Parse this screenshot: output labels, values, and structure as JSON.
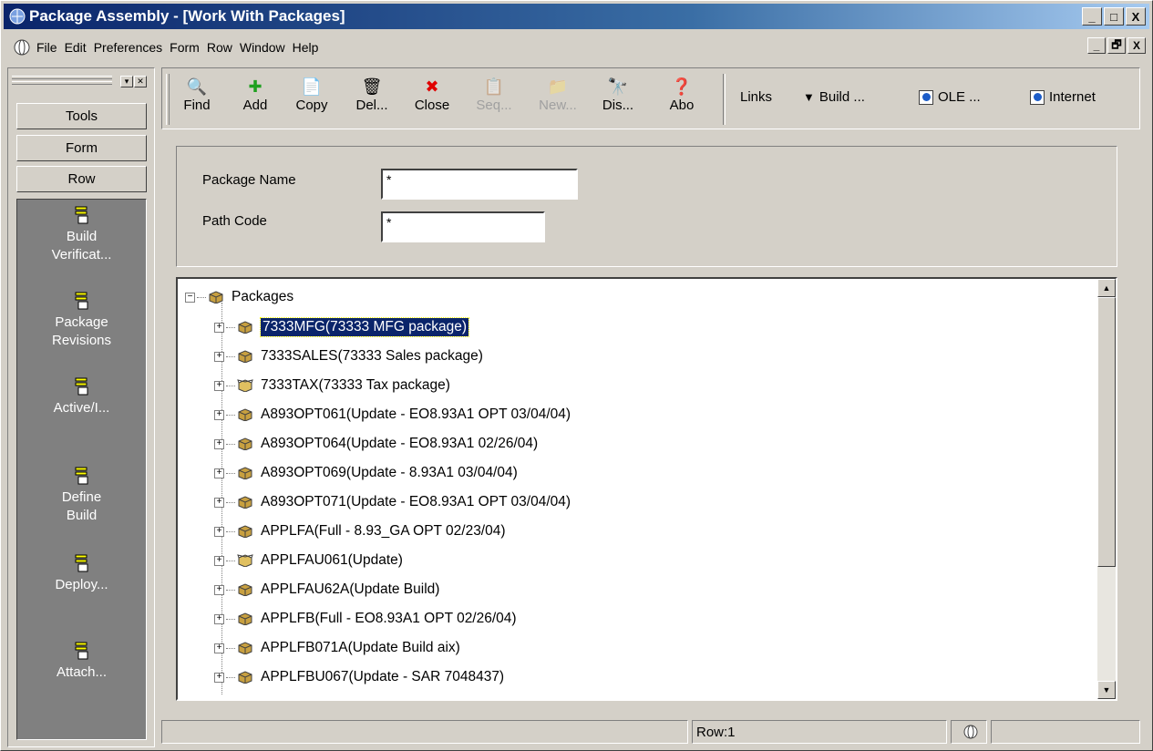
{
  "window": {
    "title": "Package Assembly - [Work With Packages]",
    "caption_buttons": [
      "_",
      "□",
      "X"
    ],
    "mdi_buttons": [
      "_",
      "🗗",
      "X"
    ]
  },
  "menu": [
    "File",
    "Edit",
    "Preferences",
    "Form",
    "Row",
    "Window",
    "Help"
  ],
  "left_panel": {
    "sections": [
      "Tools",
      "Form",
      "Row"
    ],
    "items": [
      "Build\nVerificat...",
      "Package\nRevisions",
      "Active/I...",
      "Define\nBuild",
      "Deploy...",
      "Attach..."
    ]
  },
  "toolbar": {
    "buttons": [
      {
        "label": "Find",
        "u": "i",
        "icon": "find-icon",
        "glyph": "🔍",
        "disabled": false
      },
      {
        "label": "Add",
        "u": "A",
        "icon": "add-icon",
        "glyph": "✚",
        "disabled": false
      },
      {
        "label": "Copy",
        "u": "y",
        "icon": "copy-icon",
        "glyph": "📄",
        "disabled": false
      },
      {
        "label": "Del...",
        "u": "D",
        "icon": "delete-icon",
        "glyph": "🗑",
        "disabled": false
      },
      {
        "label": "Close",
        "u": "C",
        "icon": "close-icon",
        "glyph": "✖",
        "disabled": false
      },
      {
        "label": "Seq...",
        "u": "",
        "icon": "seq-icon",
        "glyph": "📋",
        "disabled": true
      },
      {
        "label": "New...",
        "u": "",
        "icon": "new-icon",
        "glyph": "📁",
        "disabled": true
      },
      {
        "label": "Dis...",
        "u": "",
        "icon": "display-icon",
        "glyph": "🔭",
        "disabled": false
      },
      {
        "label": "Abo",
        "u": "b",
        "icon": "about-icon",
        "glyph": "❓",
        "disabled": false
      }
    ],
    "links": [
      {
        "label": "Links",
        "icon": ""
      },
      {
        "label": "Build ...",
        "icon": "dropdown-arrow-icon"
      },
      {
        "label": "OLE ...",
        "icon": "ole-icon"
      },
      {
        "label": "Internet",
        "icon": "internet-icon"
      }
    ]
  },
  "query": {
    "package_name_label": "Package Name",
    "package_name_value": "*",
    "path_code_label": "Path Code",
    "path_code_value": "*"
  },
  "tree": {
    "root": "Packages",
    "items": [
      {
        "text": "7333MFG(73333 MFG package)",
        "selected": true,
        "open_box": false
      },
      {
        "text": "7333SALES(73333 Sales package)",
        "selected": false,
        "open_box": false
      },
      {
        "text": "7333TAX(73333 Tax package)",
        "selected": false,
        "open_box": true
      },
      {
        "text": "A893OPT061(Update - EO8.93A1 OPT 03/04/04)",
        "selected": false,
        "open_box": false
      },
      {
        "text": "A893OPT064(Update - EO8.93A1 02/26/04)",
        "selected": false,
        "open_box": false
      },
      {
        "text": "A893OPT069(Update - 8.93A1 03/04/04)",
        "selected": false,
        "open_box": false
      },
      {
        "text": "A893OPT071(Update - EO8.93A1 OPT 03/04/04)",
        "selected": false,
        "open_box": false
      },
      {
        "text": "APPLFA(Full - 8.93_GA OPT 02/23/04)",
        "selected": false,
        "open_box": false
      },
      {
        "text": "APPLFAU061(Update)",
        "selected": false,
        "open_box": true
      },
      {
        "text": "APPLFAU62A(Update Build)",
        "selected": false,
        "open_box": false
      },
      {
        "text": "APPLFB(Full - EO8.93A1 OPT 02/26/04)",
        "selected": false,
        "open_box": false
      },
      {
        "text": "APPLFB071A(Update Build aix)",
        "selected": false,
        "open_box": false
      },
      {
        "text": "APPLFBU067(Update - SAR 7048437)",
        "selected": false,
        "open_box": false
      }
    ]
  },
  "status": {
    "row": "Row:1"
  }
}
